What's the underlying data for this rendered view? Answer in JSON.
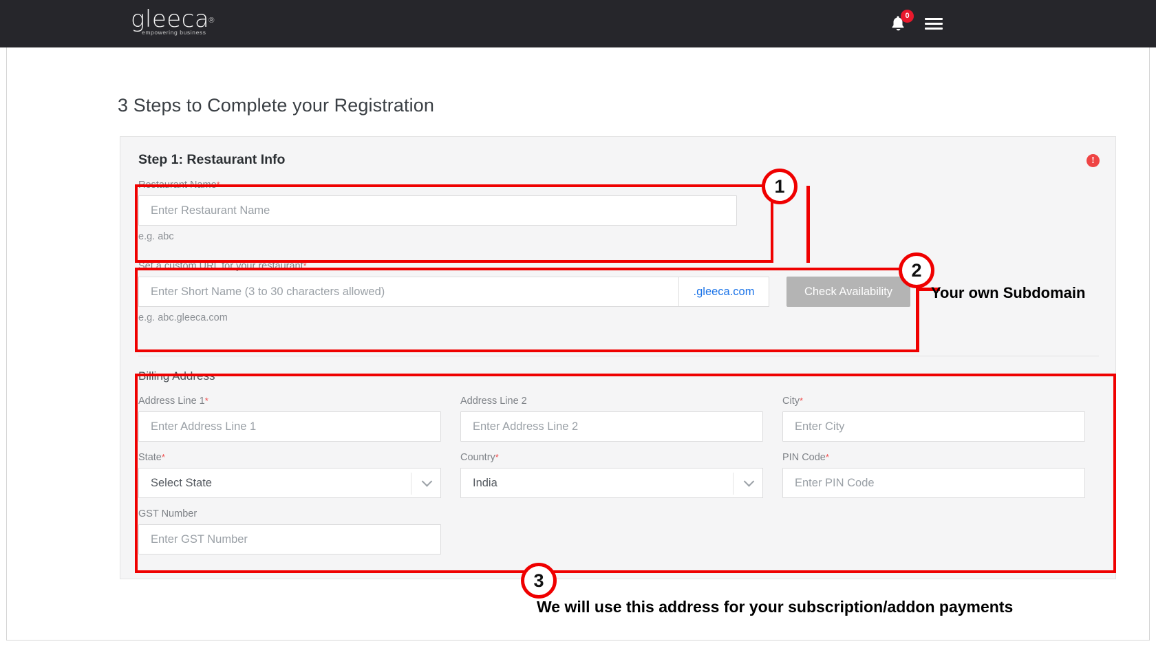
{
  "topbar": {
    "logo_text": "gleeca",
    "logo_registered": "®",
    "logo_tagline": "empowering business",
    "bell_icon": "bell-icon",
    "notification_count": "0",
    "menu_icon": "hamburger-menu-icon"
  },
  "page": {
    "title": "3 Steps to Complete your Registration"
  },
  "step": {
    "title": "Step 1: Restaurant Info",
    "error_icon": "error-alert-icon",
    "error_symbol": "!"
  },
  "fields": {
    "restaurant_name": {
      "label": "Restaurant Name",
      "required": "*",
      "placeholder": "Enter Restaurant Name",
      "value": "",
      "hint": "e.g. abc"
    },
    "custom_url": {
      "label": "Set a custom URL for your restaurant",
      "required": "*",
      "placeholder": "Enter Short Name (3 to 30 characters allowed)",
      "value": "",
      "suffix": ".gleeca.com",
      "button_label": "Check Availability",
      "hint": "e.g. abc.gleeca.com"
    }
  },
  "billing": {
    "title": "Billing Address",
    "address_line_1": {
      "label": "Address Line 1",
      "required": "*",
      "placeholder": "Enter Address Line 1",
      "value": ""
    },
    "address_line_2": {
      "label": "Address Line 2",
      "required": "",
      "placeholder": "Enter Address Line 2",
      "value": ""
    },
    "city": {
      "label": "City",
      "required": "*",
      "placeholder": "Enter City",
      "value": ""
    },
    "state": {
      "label": "State",
      "required": "*",
      "selected": "Select State",
      "caret_icon": "chevron-down-icon"
    },
    "country": {
      "label": "Country",
      "required": "*",
      "selected": "India",
      "caret_icon": "chevron-down-icon"
    },
    "pin_code": {
      "label": "PIN Code",
      "required": "*",
      "placeholder": "Enter PIN Code",
      "value": ""
    },
    "gst_number": {
      "label": "GST Number",
      "required": "",
      "placeholder": "Enter GST Number",
      "value": ""
    }
  },
  "annotations": {
    "callout_1": "1",
    "callout_2": "2",
    "callout_3": "3",
    "text_2": "Your own Subdomain",
    "text_3": "We will use this address for your subscription/addon payments",
    "accent_color": "#ef0000"
  }
}
